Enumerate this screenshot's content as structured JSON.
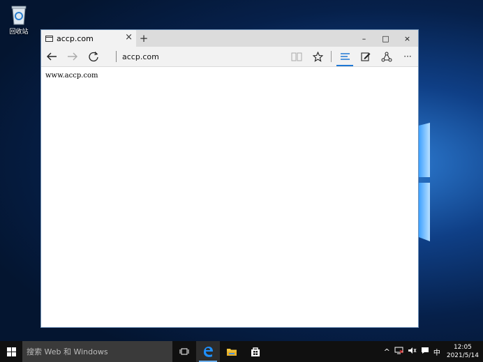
{
  "desktop": {
    "recycle_bin_label": "回收站"
  },
  "browser": {
    "tab_title": "accp.com",
    "tab_close": "×",
    "new_tab": "+",
    "window_controls": {
      "minimize": "–",
      "maximize": "□",
      "close": "×"
    },
    "address": "accp.com",
    "more_label": "···",
    "page_text": "www.accp.com",
    "accent_color": "#1e78d4"
  },
  "taskbar": {
    "search_placeholder": "搜索 Web 和 Windows",
    "tray": {
      "up_arrow": "^",
      "volume": "🔇",
      "ime": "中",
      "time": "12:05",
      "date": "2021/5/14"
    },
    "icons": [
      "start-icon",
      "task-view-icon",
      "edge-icon",
      "file-explorer-icon",
      "store-icon"
    ]
  }
}
